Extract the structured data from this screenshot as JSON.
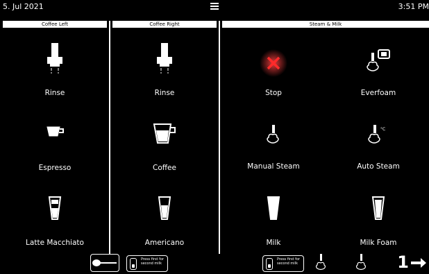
{
  "topbar": {
    "date": "5. Jul 2021",
    "time": "3:51 PM"
  },
  "headers": {
    "coffee_left": "Coffee Left",
    "coffee_right": "Coffee Right",
    "steam_milk": "Steam & Milk"
  },
  "left": {
    "rinse": "Rinse",
    "espresso": "Espresso",
    "latte": "Latte Macchiato"
  },
  "right": {
    "rinse": "Rinse",
    "coffee": "Coffee",
    "americano": "Americano"
  },
  "steam": {
    "stop": "Stop",
    "everfoam": "Everfoam",
    "manual": "Manual Steam",
    "auto": "Auto Steam",
    "milk": "Milk",
    "milkfoam": "Milk Foam"
  },
  "bottom": {
    "press_first": "Press first for second milk",
    "page_number": "1",
    "auto_steam_unit": "°C"
  },
  "colors": {
    "accent_stop": "#ff2a2a",
    "bg": "#000000",
    "fg": "#ffffff"
  }
}
